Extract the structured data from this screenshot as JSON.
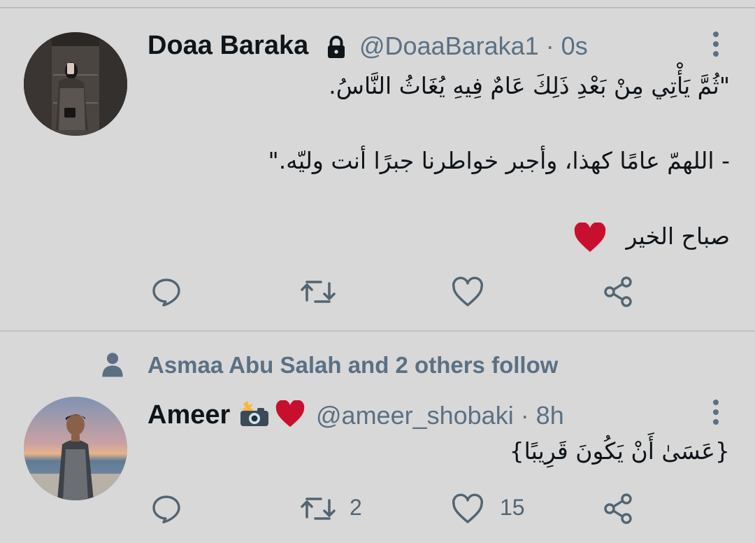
{
  "tweet1": {
    "name": "Doaa Baraka",
    "handle": "@DoaaBaraka1 · 0s",
    "lines": [
      "\"ثُمَّ يَأْتِي مِنْ بَعْدِ ذَلِكَ عَامٌ فِيهِ يُغَاثُ النَّاسُ.",
      "- اللهمّ عامًا كهذا، وأجبر خواطرنا جبرًا أنت وليّه.\"",
      "صباح الخير"
    ],
    "icons": [
      "lock-icon",
      "red-heart-emoji"
    ]
  },
  "social_context": {
    "text": "Asmaa Abu Salah and 2 others follow"
  },
  "tweet2": {
    "name": "Ameer",
    "handle": "@ameer_shobaki · 8h",
    "text": "{عَسَىٰ أَنْ يَكُونَ قَرِيبًا}",
    "retweets": "2",
    "likes": "15",
    "icons": [
      "camera-flash-emoji",
      "red-heart-emoji"
    ]
  },
  "colors": {
    "background": "#d8d8d8",
    "secondary_text": "#5b7083",
    "heart_red": "#c8102e"
  }
}
